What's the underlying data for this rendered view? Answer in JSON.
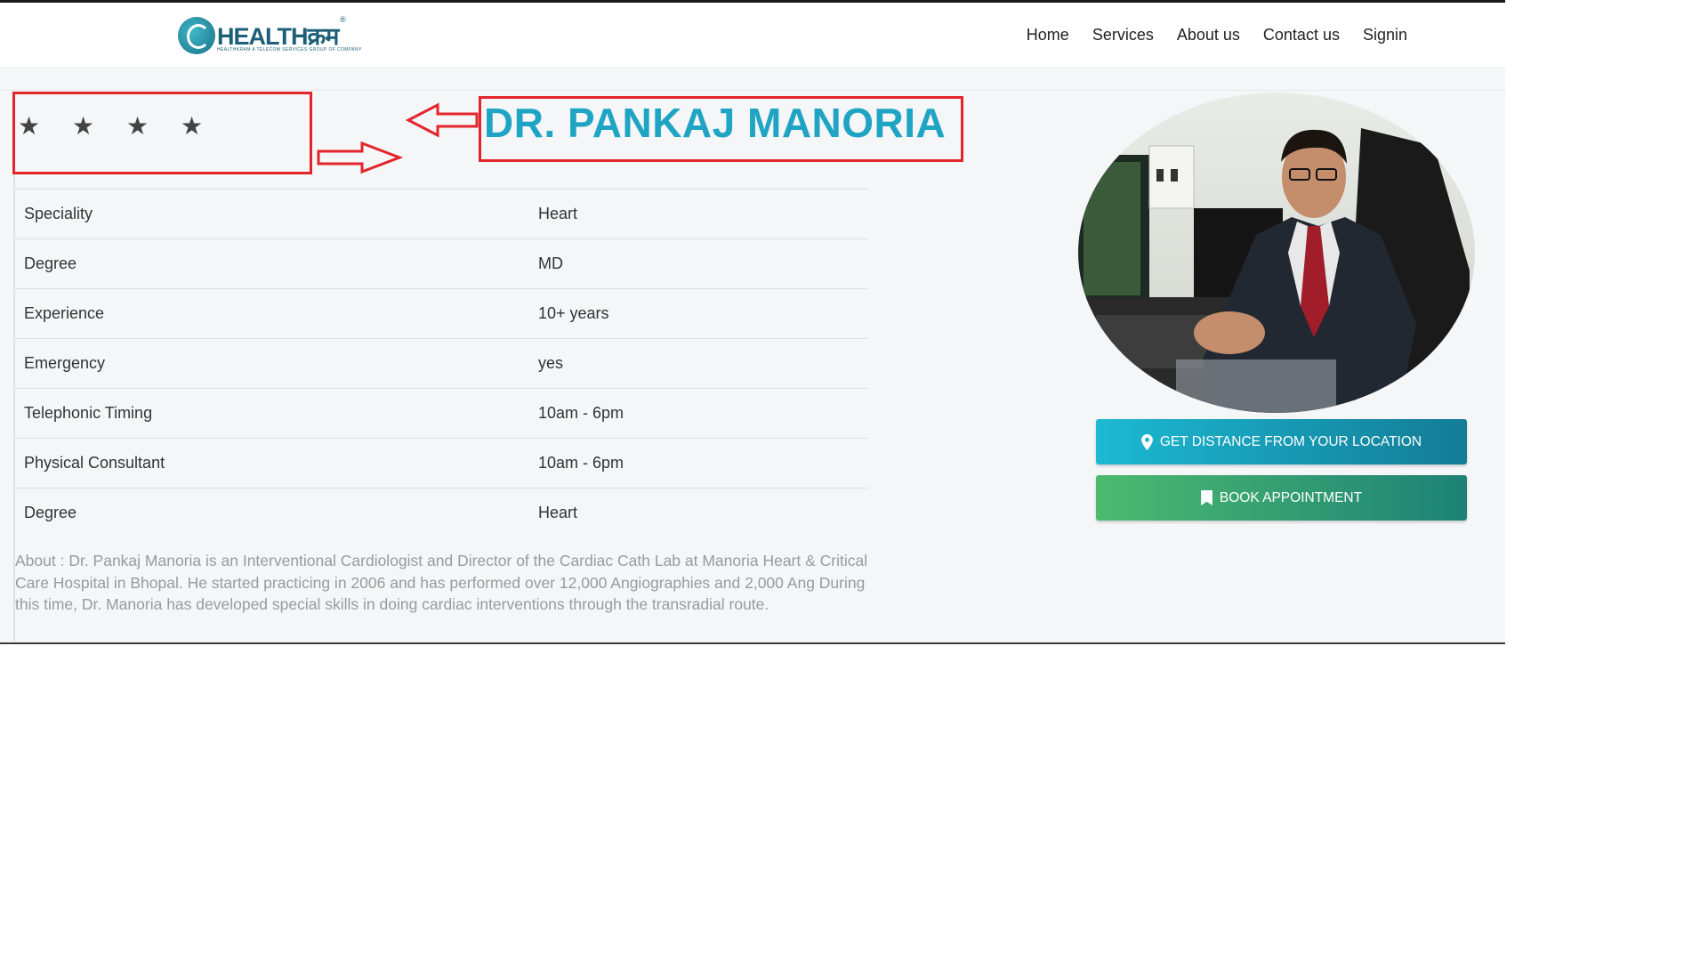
{
  "nav": {
    "logo_text": "HEALTHक्रम",
    "logo_reg": "®",
    "logo_tagline": "HEALTHKRAM A TELECOM SERVICES GROUP OF COMPANY",
    "links": [
      "Home",
      "Services",
      "About us",
      "Contact us",
      "Signin"
    ]
  },
  "rating": {
    "stars_shown": 4,
    "star_glyph": "★"
  },
  "doctor": {
    "name": "DR. PANKAJ MANORIA",
    "details": [
      {
        "label": "Speciality",
        "value": "Heart"
      },
      {
        "label": "Degree",
        "value": "MD"
      },
      {
        "label": "Experience",
        "value": "10+ years"
      },
      {
        "label": "Emergency",
        "value": "yes"
      },
      {
        "label": "Telephonic Timing",
        "value": "10am - 6pm"
      },
      {
        "label": "Physical Consultant",
        "value": "10am - 6pm"
      },
      {
        "label": "Degree",
        "value": "Heart"
      }
    ],
    "about": "About : Dr. Pankaj Manoria is an Interventional Cardiologist and Director of the Cardiac Cath Lab at Manoria Heart & Critical Care Hospital in Bhopal. He started practicing in 2006 and has performed over 12,000 Angiographies and 2,000 Ang During this time, Dr. Manoria has developed special skills in doing cardiac interventions through the transradial route."
  },
  "actions": {
    "distance_label": "GET DISTANCE FROM YOUR LOCATION",
    "distance_icon": "map-pin-icon",
    "book_label": "BOOK APPOINTMENT",
    "book_icon": "bookmark-icon"
  },
  "colors": {
    "name_color": "#1fa4c4",
    "annotation_red": "#e3242b",
    "distance_button": "#17a2b8",
    "book_button": "#3aa776"
  }
}
